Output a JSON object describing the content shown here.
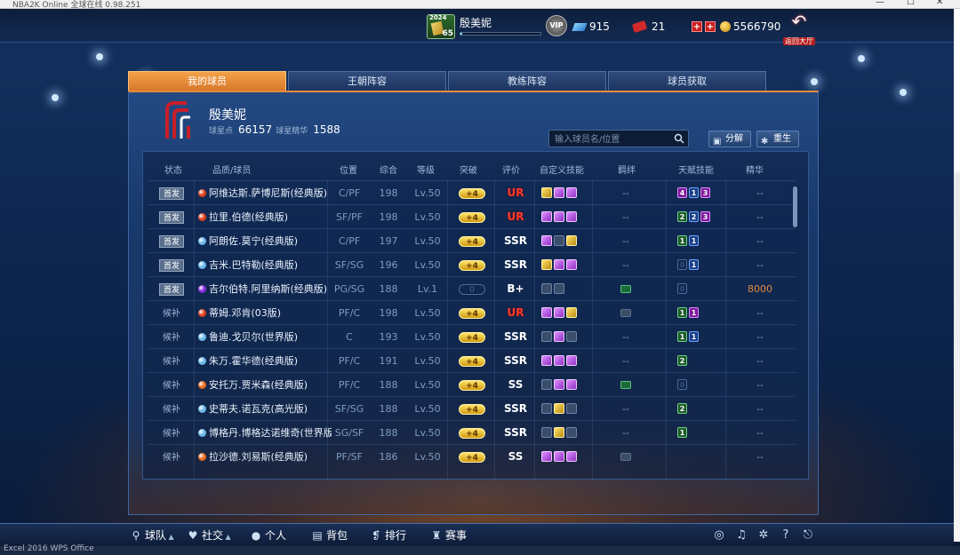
{
  "window": {
    "title": "NBA2K Online 全球在线 0.98.251"
  },
  "hud": {
    "avatar_year": "2024",
    "avatar_level": "65",
    "player_name": "殷美妮",
    "badge_text": "VIP",
    "diamonds": "915",
    "tickets": "21",
    "coins": "5566790",
    "back_label": "返回大厅"
  },
  "tabs": [
    {
      "label": "我的球员"
    },
    {
      "label": "王朝阵容"
    },
    {
      "label": "教练阵容"
    },
    {
      "label": "球员获取"
    }
  ],
  "team": {
    "name": "殷美妮",
    "star_points_label": "球星点",
    "star_points": "66157",
    "essence_label": "球星精华",
    "essence": "1588"
  },
  "search": {
    "placeholder": "输入球员名/位置"
  },
  "actions": {
    "decompose": "分解",
    "rebirth": "重生"
  },
  "columns": [
    "状态",
    "品质/球员",
    "位置",
    "综合",
    "等级",
    "突破",
    "评价",
    "自定义技能",
    "羁绊",
    "天赋技能",
    "精华"
  ],
  "colors": {
    "accent": "#e58b3b",
    "red_quality": "#e0401f",
    "blue_quality": "#6bb6e8",
    "purple_quality": "#8a2be2",
    "orange_quality": "#e8691f"
  },
  "rows": [
    {
      "status": "首发",
      "quality": "red",
      "name": "阿维达斯.萨博尼斯(经典版)",
      "pos": "C/PF",
      "ovr": "198",
      "lvl": "Lv.50",
      "brk": "+4",
      "grade": "UR",
      "skills": [
        "g",
        "p",
        "p"
      ],
      "bond": "--",
      "talents": [
        [
          "pu",
          "4"
        ],
        [
          "bl",
          "1"
        ],
        [
          "pu",
          "3"
        ]
      ],
      "ess": "--"
    },
    {
      "status": "首发",
      "quality": "red",
      "name": "拉里.伯德(经典版)",
      "pos": "SF/PF",
      "ovr": "198",
      "lvl": "Lv.50",
      "brk": "+4",
      "grade": "UR",
      "skills": [
        "p",
        "p",
        "p"
      ],
      "bond": "--",
      "talents": [
        [
          "gr",
          "2"
        ],
        [
          "bl",
          "2"
        ],
        [
          "pu",
          "3"
        ]
      ],
      "ess": "--"
    },
    {
      "status": "首发",
      "quality": "blue",
      "name": "阿朗佐.莫宁(经典版)",
      "pos": "C/PF",
      "ovr": "197",
      "lvl": "Lv.50",
      "brk": "+4",
      "grade": "SSR",
      "skills": [
        "p",
        "e",
        "g"
      ],
      "bond": "--",
      "talents": [
        [
          "gr",
          "1"
        ],
        [
          "bl",
          "1"
        ]
      ],
      "ess": "--"
    },
    {
      "status": "首发",
      "quality": "blue",
      "name": "吉米.巴特勒(经典版)",
      "pos": "SF/SG",
      "ovr": "196",
      "lvl": "Lv.50",
      "brk": "+4",
      "grade": "SSR",
      "skills": [
        "g",
        "p",
        "p"
      ],
      "bond": "--",
      "talents": [
        [
          "z",
          "0"
        ],
        [
          "bl",
          "1"
        ]
      ],
      "ess": "--"
    },
    {
      "status": "首发",
      "quality": "purple",
      "name": "吉尔伯特.阿里纳斯(经典版)",
      "pos": "PG/SG",
      "ovr": "188",
      "lvl": "Lv.1",
      "brk": "0",
      "grade": "B+",
      "skills": [
        "l",
        "e"
      ],
      "bond": "icon",
      "talents": [
        [
          "z",
          "0"
        ]
      ],
      "ess": "8000"
    },
    {
      "status": "候补",
      "quality": "red",
      "name": "蒂姆.邓肯(03版)",
      "pos": "PF/C",
      "ovr": "198",
      "lvl": "Lv.50",
      "brk": "+4",
      "grade": "UR",
      "skills": [
        "p",
        "p",
        "g"
      ],
      "bond": "dim",
      "talents": [
        [
          "gr",
          "1"
        ],
        [
          "pu",
          "1"
        ]
      ],
      "ess": "--"
    },
    {
      "status": "候补",
      "quality": "blue",
      "name": "鲁迪.戈贝尔(世界版)",
      "pos": "C",
      "ovr": "193",
      "lvl": "Lv.50",
      "brk": "+4",
      "grade": "SSR",
      "skills": [
        "e",
        "p",
        "e"
      ],
      "bond": "--",
      "talents": [
        [
          "gr",
          "1"
        ],
        [
          "bl",
          "1"
        ]
      ],
      "ess": "--"
    },
    {
      "status": "候补",
      "quality": "blue",
      "name": "朱万.霍华德(经典版)",
      "pos": "PF/C",
      "ovr": "191",
      "lvl": "Lv.50",
      "brk": "+4",
      "grade": "SSR",
      "skills": [
        "p",
        "p",
        "p"
      ],
      "bond": "--",
      "talents": [
        [
          "gr",
          "2"
        ]
      ],
      "ess": "--"
    },
    {
      "status": "候补",
      "quality": "orange",
      "name": "安托万.贾米森(经典版)",
      "pos": "PF/C",
      "ovr": "188",
      "lvl": "Lv.50",
      "brk": "+4",
      "grade": "SS",
      "skills": [
        "e",
        "p",
        "p"
      ],
      "bond": "icon",
      "talents": [
        [
          "z",
          "0"
        ]
      ],
      "ess": "--"
    },
    {
      "status": "候补",
      "quality": "blue",
      "name": "史蒂夫.诺瓦克(高光版)",
      "pos": "SF/SG",
      "ovr": "188",
      "lvl": "Lv.50",
      "brk": "+4",
      "grade": "SSR",
      "skills": [
        "e",
        "g",
        "e"
      ],
      "bond": "--",
      "talents": [
        [
          "gr",
          "2"
        ]
      ],
      "ess": "--"
    },
    {
      "status": "候补",
      "quality": "blue",
      "name": "博格丹.博格达诺维奇(世界版)",
      "pos": "SG/SF",
      "ovr": "188",
      "lvl": "Lv.50",
      "brk": "+4",
      "grade": "SSR",
      "skills": [
        "e",
        "g",
        "e"
      ],
      "bond": "--",
      "talents": [
        [
          "gr",
          "1"
        ]
      ],
      "ess": "--"
    },
    {
      "status": "候补",
      "quality": "orange",
      "name": "拉沙德.刘易斯(经典版)",
      "pos": "PF/SF",
      "ovr": "186",
      "lvl": "Lv.50",
      "brk": "+4",
      "grade": "SS",
      "skills": [
        "p",
        "p",
        "p"
      ],
      "bond": "dim",
      "talents": [],
      "ess": "--"
    }
  ],
  "bottom": {
    "team": "球队",
    "social": "社交",
    "personal": "个人",
    "bag": "背包",
    "rank": "排行",
    "match": "赛事"
  },
  "taskbar": {
    "text": "Excel 2016    WPS Office"
  }
}
